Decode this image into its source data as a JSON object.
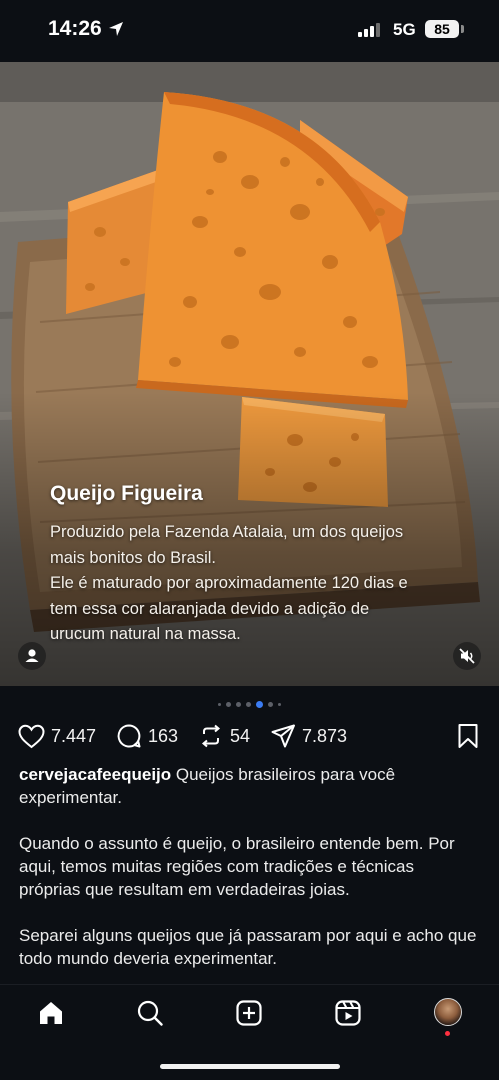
{
  "status_bar": {
    "time": "14:26",
    "network": "5G",
    "battery": "85",
    "icons": [
      "location-arrow-icon",
      "signal-bars-icon"
    ]
  },
  "post": {
    "image_overlay": {
      "title": "Queijo Figueira",
      "lines": [
        "Produzido pela Fazenda Atalaia, um dos queijos",
        "mais bonitos do Brasil.",
        "Ele é maturado por aproximadamente 120 dias e",
        "tem essa cor alaranjada devido a adição de",
        "urucum natural na massa."
      ],
      "icons": [
        "user-tag-icon",
        "muted-speaker-icon"
      ]
    },
    "carousel": {
      "total": 7,
      "active_index": 4
    },
    "actions": {
      "likes": "7.447",
      "comments": "163",
      "reposts": "54",
      "shares": "7.873",
      "icons": [
        "heart-icon",
        "comment-icon",
        "repost-icon",
        "send-icon",
        "bookmark-icon"
      ]
    },
    "caption": {
      "username": "cervejacafeequeijo",
      "first_text": " Queijos brasileiros para você experimentar.",
      "paragraph_2": "Quando o assunto é queijo, o brasileiro entende bem. Por aqui, temos muitas regiões com tradições e técnicas próprias que resultam em verdadeiras joias.",
      "paragraph_3": "Separei alguns queijos que já passaram por aqui e acho que todo mundo deveria experimentar."
    }
  },
  "bottom_nav": {
    "items": [
      "home-icon",
      "search-icon",
      "create-icon",
      "reels-icon",
      "profile-avatar"
    ],
    "active": "home-icon"
  },
  "colors": {
    "background": "#0c0f14",
    "cheese": "#e88a2a",
    "active_dot": "#3b7cf3",
    "notification": "#ff3040"
  }
}
